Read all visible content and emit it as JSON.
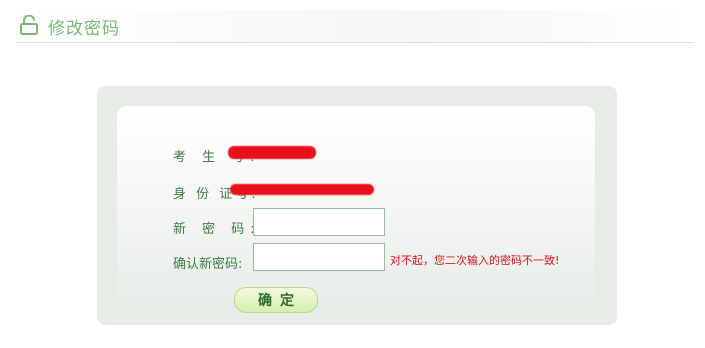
{
  "header": {
    "title": "修改密码",
    "icon": "lock-icon",
    "accent_color": "#79b87a"
  },
  "form": {
    "exam_number_label": "考 生 号:",
    "id_number_label": "身 份 证号:",
    "new_password_label": "新 密 码:",
    "confirm_password_label": "确认新密码:",
    "new_password_value": "",
    "confirm_password_value": "",
    "error_message": "对不起，您二次输入的密码不一致!",
    "submit_label": "确定"
  }
}
